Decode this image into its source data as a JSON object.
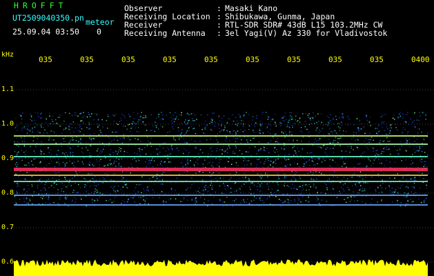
{
  "header": {
    "brand": "HROFFT",
    "filename": "UT2509040350.pn",
    "tag": "meteor",
    "timestamp": "25.09.04 03:50",
    "counter": "0",
    "observer_label": "Observer",
    "observer_value": "Masaki Kano",
    "location_label": "Receiving Location",
    "location_value": "Shibukawa, Gunma, Japan",
    "receiver_label": "Receiver",
    "receiver_value": "RTL-SDR SDR# 43dB L15 103.2MHz CW",
    "antenna_label": "Receiving Antenna",
    "antenna_value": "3el Yagi(V) Az 330 for Vladivostok",
    "sep": ":"
  },
  "axis": {
    "y_unit": "kHz",
    "y_ticks": [
      "1.1",
      "1.0",
      "0.9",
      "0.8",
      "0.7",
      "0.6"
    ],
    "x_ticks": [
      "035",
      "035",
      "035",
      "035",
      "035",
      "035",
      "035",
      "035",
      "035",
      "0400"
    ]
  },
  "colors": {
    "background": "#000000",
    "text_yellow": "#ffff00",
    "text_green": "#33ff33",
    "text_cyan": "#33ffff",
    "echo_band": "#ff3366",
    "noise_blue": "#2244cc",
    "noise_cyan": "#22cccc",
    "amplitude": "#ffff00"
  }
}
